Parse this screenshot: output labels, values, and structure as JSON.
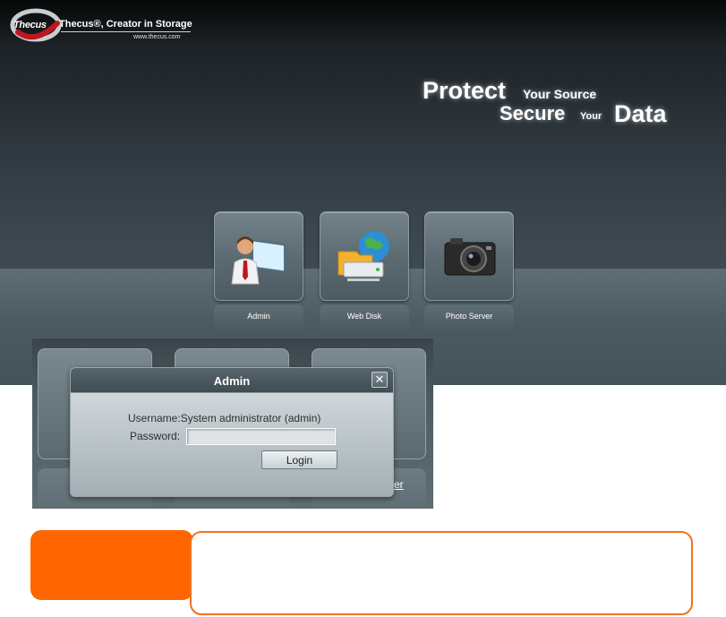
{
  "header": {
    "brand": "Thecus",
    "tagline": "Thecus®, Creator in Storage",
    "url": "www.thecus.com"
  },
  "slogan": {
    "line1_big": "Protect",
    "line1_small": "Your Source",
    "line2_big": "Secure",
    "line2_small": "Your",
    "line2_big2": "Data"
  },
  "apps": [
    {
      "label": "Admin",
      "icon": "admin-user-monitor-icon"
    },
    {
      "label": "Web Disk",
      "icon": "web-disk-globe-folder-icon"
    },
    {
      "label": "Photo Server",
      "icon": "camera-icon"
    }
  ],
  "login_dialog": {
    "title": "Admin",
    "close_glyph": "✕",
    "username_text": "Username:System administrator (admin)",
    "password_label": "Password:",
    "password_value": "",
    "login_button": "Login",
    "background_partial_label": "er"
  },
  "colors": {
    "callout_orange": "#ff6600",
    "callout_border": "#f07320"
  }
}
